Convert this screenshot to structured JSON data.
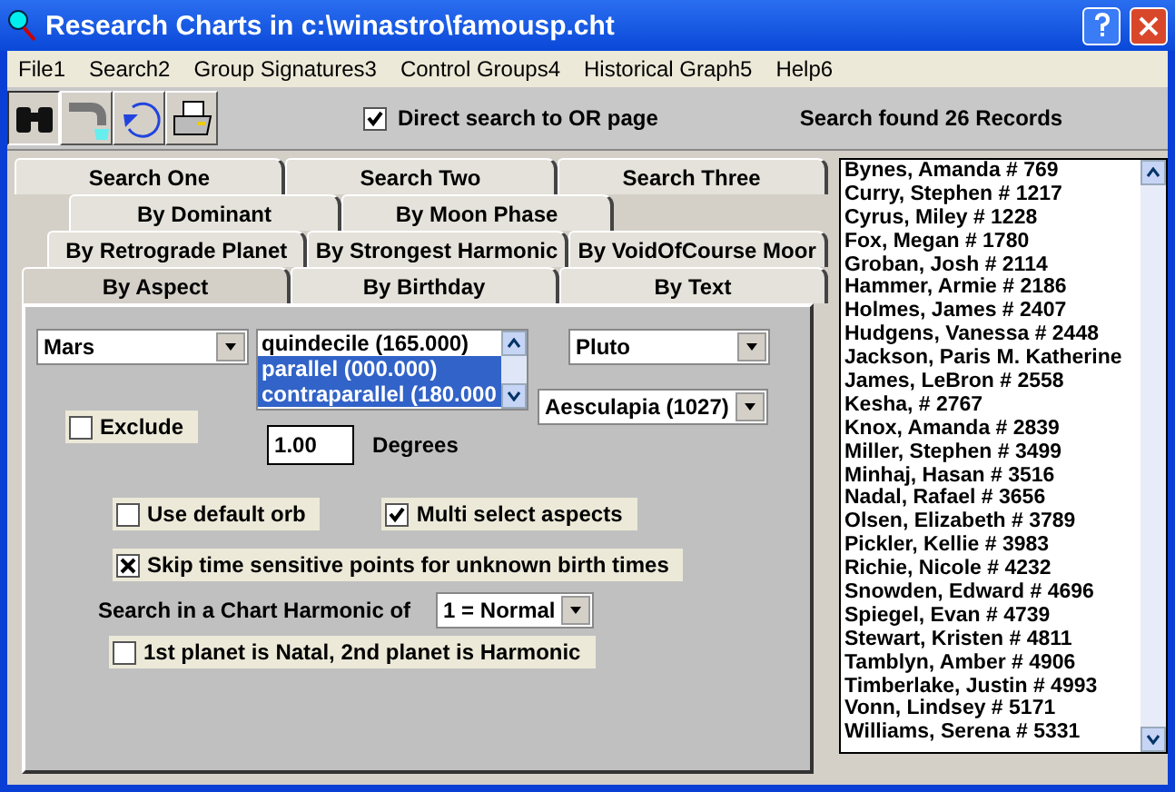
{
  "window": {
    "title": "Research Charts in c:\\winastro\\famousp.cht"
  },
  "menu": [
    "File1",
    "Search2",
    "Group Signatures3",
    "Control Groups4",
    "Historical Graph5",
    "Help6"
  ],
  "toolbar": {
    "direct_search": {
      "label": "Direct search to OR page",
      "checked": true
    },
    "status": "Search found 26 Records"
  },
  "tab_rows": [
    [
      {
        "label": "Search One"
      },
      {
        "label": "Search Two"
      },
      {
        "label": "Search Three"
      }
    ],
    [
      {
        "label": "By Dominant",
        "selected": false
      },
      {
        "label": "By Moon Phase",
        "selected": false
      }
    ],
    [
      {
        "label": "By Retrograde Planet",
        "selected": false
      },
      {
        "label": "By Strongest Harmonic",
        "selected": false
      },
      {
        "label": "By VoidOfCourse Moor",
        "selected": false
      }
    ],
    [
      {
        "label": "By Aspect",
        "selected": true
      },
      {
        "label": "By Birthday",
        "selected": false
      },
      {
        "label": "By Text",
        "selected": false
      }
    ]
  ],
  "aspect": {
    "planet_1": "Mars",
    "aspects": [
      {
        "label": "quindecile (165.000)",
        "selected": false
      },
      {
        "label": "parallel (000.000)",
        "selected": true
      },
      {
        "label": "contraparallel (180.000",
        "selected": true
      }
    ],
    "planet_2": "Pluto",
    "asteroid": "Aesculapia (1027)",
    "exclude": {
      "label": "Exclude",
      "checked": false
    },
    "orb": "1.00",
    "orb_unit": "Degrees",
    "options": [
      {
        "label": "Use default orb",
        "checked": false
      },
      {
        "label": "Multi select aspects",
        "checked": true
      }
    ],
    "skip": {
      "label": "Skip time sensitive points for unknown birth times",
      "checked": true,
      "kind": "cross"
    },
    "harmonic_label": "Search in a Chart Harmonic of",
    "harmonic": "1 = Normal",
    "natal": {
      "label": "1st planet is Natal, 2nd planet is Harmonic",
      "checked": false
    }
  },
  "results": [
    "Bynes, Amanda  # 769",
    "Curry, Stephen  # 1217",
    "Cyrus, Miley  # 1228",
    "Fox, Megan  # 1780",
    "Groban, Josh  # 2114",
    "Hammer, Armie  # 2186",
    "Holmes, James  # 2407",
    "Hudgens, Vanessa  # 2448",
    "Jackson, Paris M. Katherine",
    "James, LeBron  # 2558",
    "Kesha,   # 2767",
    "Knox, Amanda  # 2839",
    "Miller, Stephen  # 3499",
    "Minhaj, Hasan  # 3516",
    "Nadal, Rafael  # 3656",
    "Olsen, Elizabeth  # 3789",
    "Pickler, Kellie  # 3983",
    "Richie, Nicole  # 4232",
    "Snowden, Edward  # 4696",
    "Spiegel, Evan  # 4739",
    "Stewart, Kristen  # 4811",
    "Tamblyn, Amber  # 4906",
    "Timberlake, Justin  # 4993",
    "Vonn, Lindsey  # 5171",
    "Williams, Serena  # 5331"
  ]
}
